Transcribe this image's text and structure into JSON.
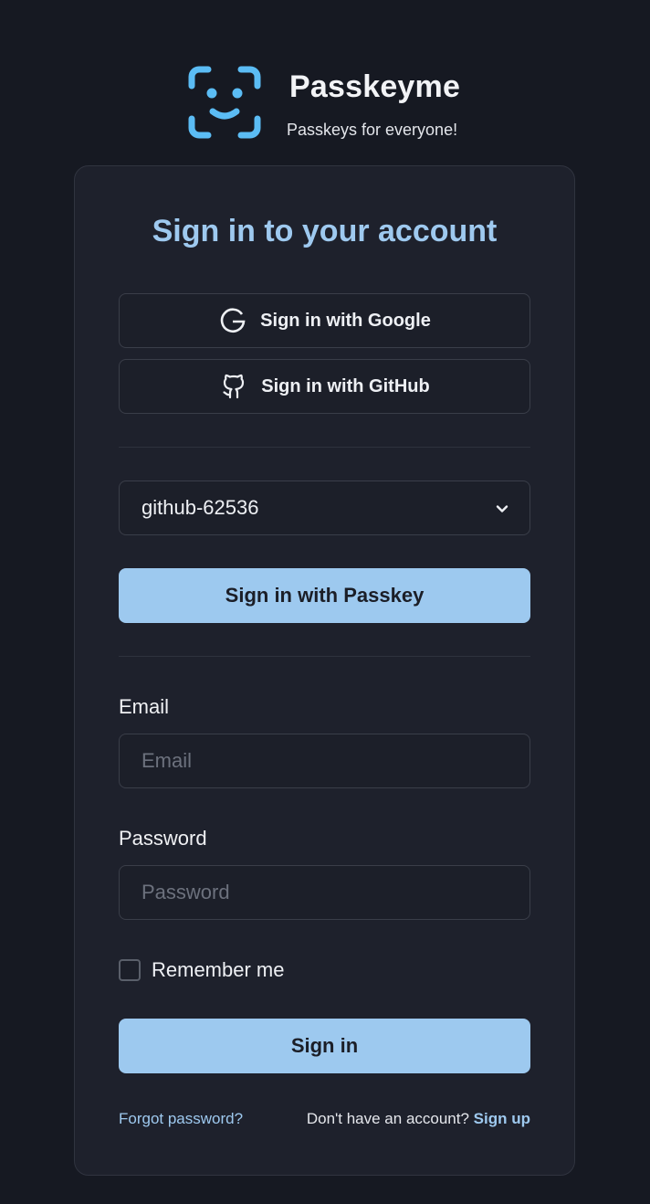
{
  "brand": {
    "name": "Passkeyme",
    "tagline": "Passkeys for everyone!"
  },
  "card": {
    "title": "Sign in to your account",
    "google_label": "Sign in with Google",
    "github_label": "Sign in with GitHub",
    "passkey_select_value": "github-62536",
    "passkey_button_label": "Sign in with Passkey",
    "email_label": "Email",
    "email_placeholder": "Email",
    "email_value": "",
    "password_label": "Password",
    "password_placeholder": "Password",
    "password_value": "",
    "remember_label": "Remember me",
    "remember_checked": false,
    "submit_label": "Sign in",
    "forgot_link": "Forgot password?",
    "no_account_text": "Don't have an account?",
    "signup_link": "Sign up"
  },
  "colors": {
    "background": "#161922",
    "card": "#1e212c",
    "accent": "#9dc9ef",
    "logo": "#5bbcf4"
  },
  "icons": {
    "logo": "face-id-icon",
    "google": "google-icon",
    "github": "github-icon",
    "select": "chevron-down-icon"
  }
}
